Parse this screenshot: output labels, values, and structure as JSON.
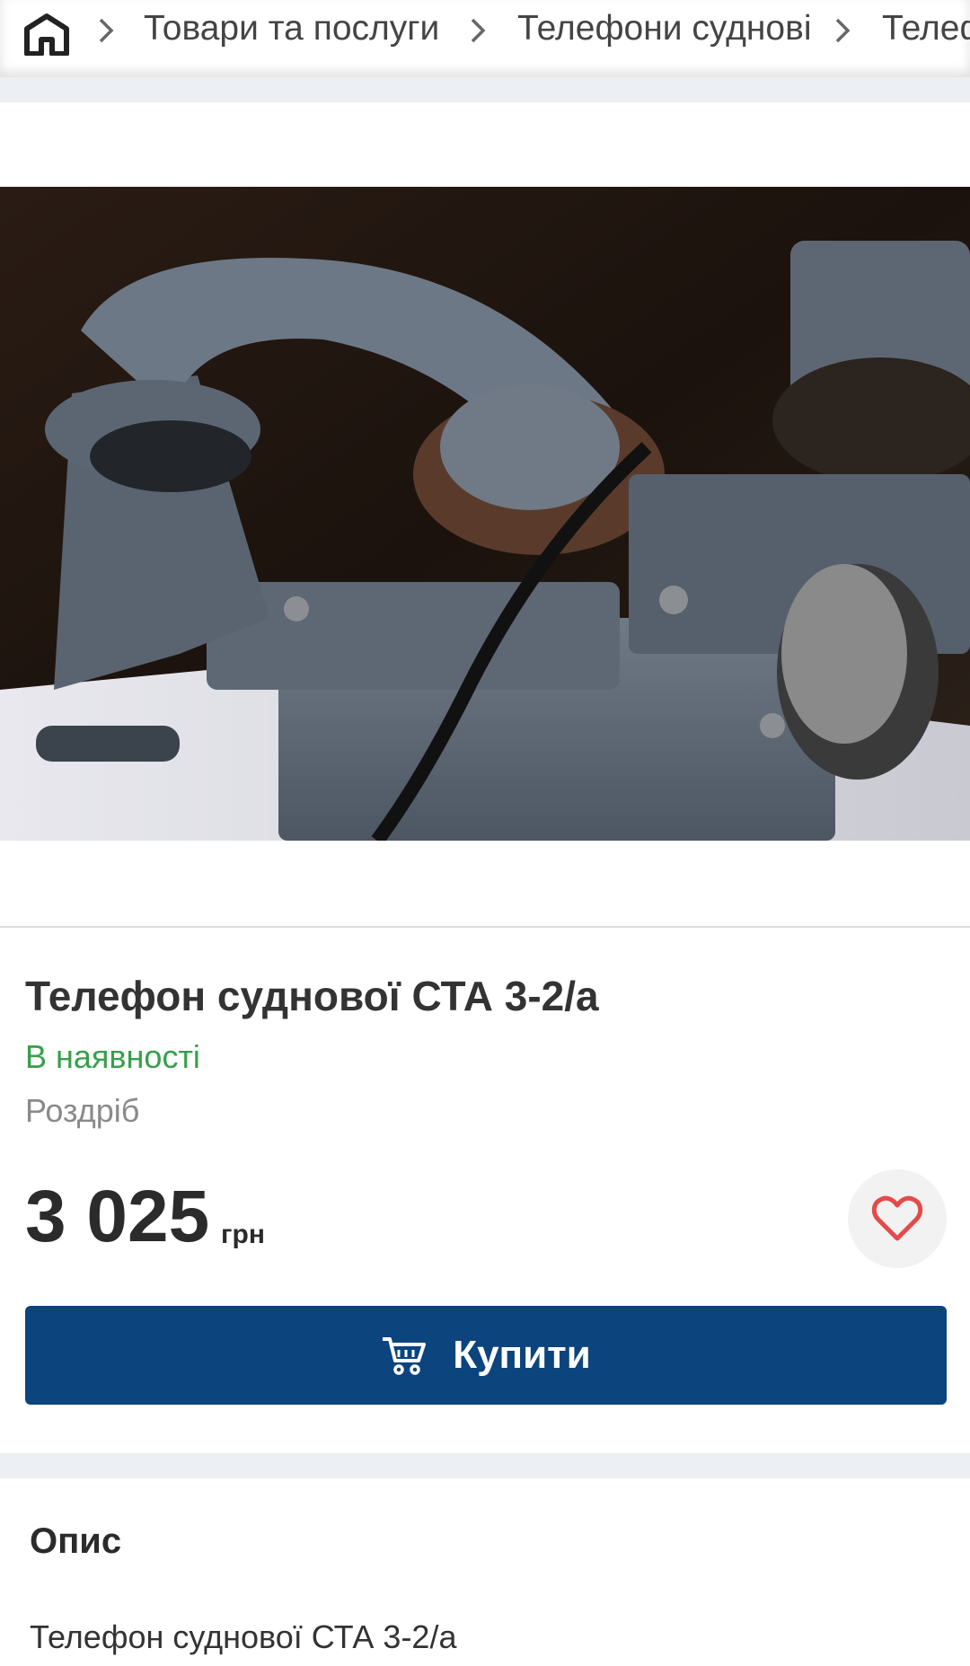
{
  "breadcrumb": {
    "items": [
      "Товари та послуги",
      "Телефони суднові",
      "Телеф"
    ]
  },
  "product": {
    "title": "Телефон суднової СТА 3-2/а",
    "availability": "В наявності",
    "sale_type": "Роздріб",
    "price": "3 025",
    "currency": "грн",
    "buy_label": "Купити"
  },
  "description": {
    "heading": "Опис",
    "text": "Телефон суднової СТА 3-2/а"
  },
  "colors": {
    "accent": "#0c447e",
    "in_stock": "#36a04a",
    "heart": "#e34b4b"
  },
  "icons": [
    "home-icon",
    "chevron-right-icon",
    "heart-icon",
    "cart-icon"
  ]
}
